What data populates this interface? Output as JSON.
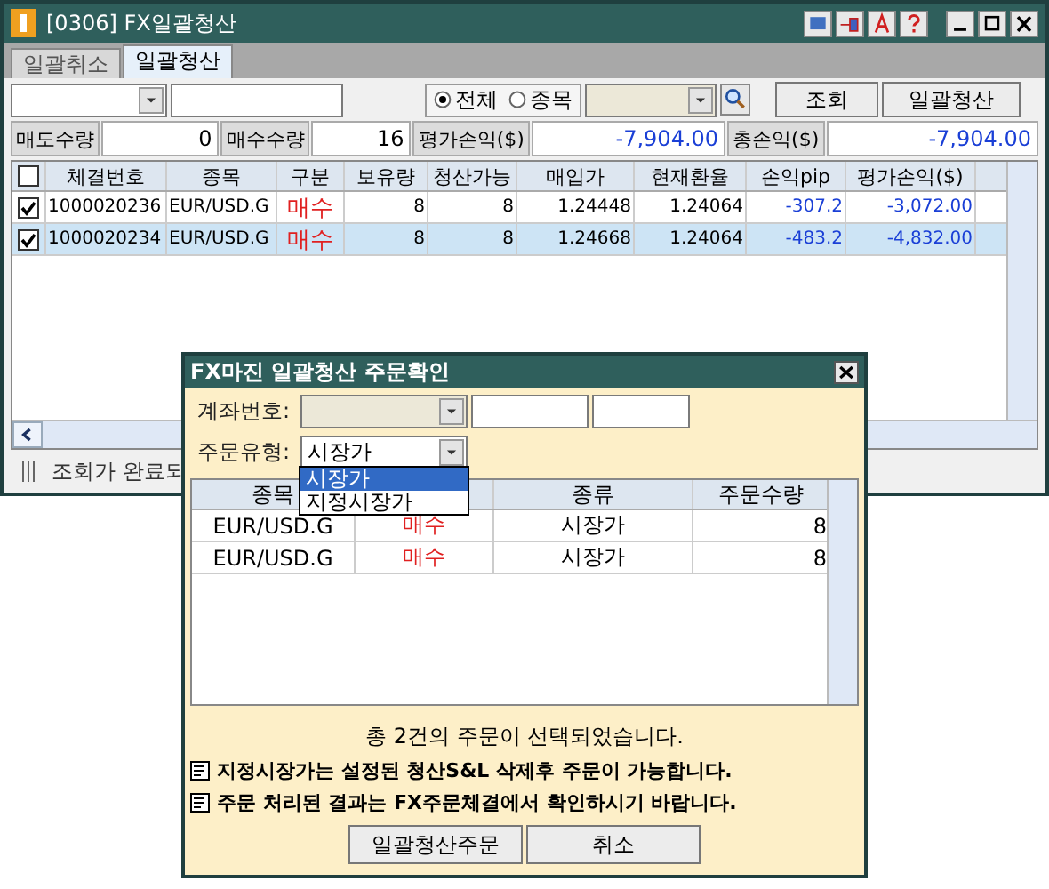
{
  "window": {
    "title": "[0306] FX일괄청산"
  },
  "tabs": [
    {
      "label": "일괄취소",
      "selected": false
    },
    {
      "label": "일괄청산",
      "selected": true
    }
  ],
  "filter": {
    "scope": [
      {
        "label": "전체",
        "selected": true
      },
      {
        "label": "종목",
        "selected": false
      }
    ],
    "buttons": [
      "조회",
      "일괄청산"
    ]
  },
  "summary": [
    {
      "label": "매도수량",
      "value": "0",
      "color": "#000000"
    },
    {
      "label": "매수수량",
      "value": "16",
      "color": "#000000"
    },
    {
      "label": "평가손익($)",
      "value": "-7,904.00",
      "color": "#1a3fd6"
    },
    {
      "label": "총손익($)",
      "value": "-7,904.00",
      "color": "#1a3fd6"
    }
  ],
  "table": {
    "header_checked": false,
    "columns": [
      "체결번호",
      "종목",
      "구분",
      "보유량",
      "청산가능",
      "매입가",
      "현재환율",
      "손익pip",
      "평가손익($)"
    ],
    "rows": [
      {
        "checked": true,
        "selected": false,
        "cells": [
          "1000020236",
          "EUR/USD.G",
          "매수",
          "8",
          "8",
          "1.24448",
          "1.24064",
          "-307.2",
          "-3,072.00"
        ]
      },
      {
        "checked": true,
        "selected": true,
        "cells": [
          "1000020234",
          "EUR/USD.G",
          "매수",
          "8",
          "8",
          "1.24668",
          "1.24064",
          "-483.2",
          "-4,832.00"
        ]
      }
    ]
  },
  "status": "조회가 완료되",
  "dialog": {
    "title": "FX마진 일괄청산 주문확인",
    "account_label": "계좌번호:",
    "order_type_label": "주문유형:",
    "order_type_value": "시장가",
    "dropdown": [
      {
        "label": "시장가",
        "selected": true
      },
      {
        "label": "지정시장가",
        "selected": false
      }
    ],
    "table": {
      "columns": [
        "종목",
        "",
        "종류",
        "주문수량"
      ],
      "rows": [
        {
          "cells": [
            "EUR/USD.G",
            "매수",
            "시장가",
            "8"
          ]
        },
        {
          "cells": [
            "EUR/USD.G",
            "매수",
            "시장가",
            "8"
          ]
        }
      ]
    },
    "message": "총 2건의 주문이 선택되었습니다.",
    "notes": [
      "지정시장가는 설정된 청산S&L 삭제후 주문이 가능합니다.",
      "주문 처리된 결과는 FX주문체결에서 확인하시기 바랍니다."
    ],
    "buttons": [
      "일괄청산주문",
      "취소"
    ]
  }
}
